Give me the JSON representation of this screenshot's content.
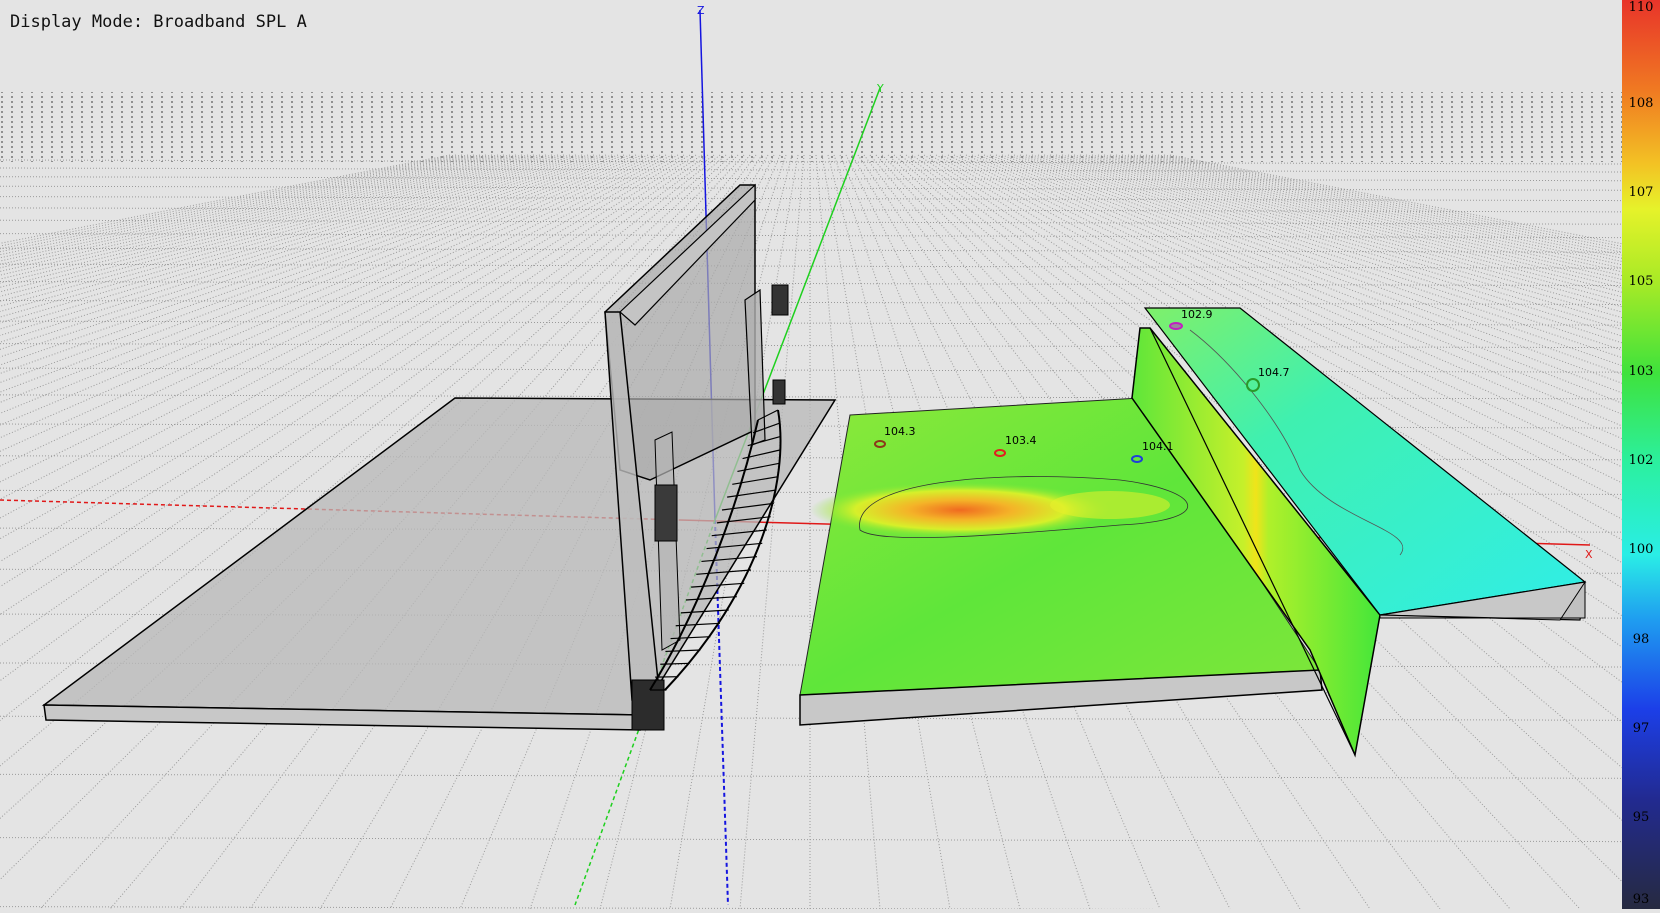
{
  "display_mode": "Display Mode: Broadband SPL A",
  "axes": {
    "x": "X",
    "y": "Y",
    "z": "Z"
  },
  "colorbar": {
    "ticks": [
      "110",
      "108",
      "107",
      "105",
      "103",
      "102",
      "100",
      "98",
      "97",
      "95",
      "93"
    ]
  },
  "probes": [
    {
      "label": "104.3",
      "color": "#8b3a1a"
    },
    {
      "label": "103.4",
      "color": "#e02020"
    },
    {
      "label": "104.1",
      "color": "#1f3fd8"
    },
    {
      "label": "102.9",
      "color": "#c020c0"
    },
    {
      "label": "104.7",
      "color": "#2a9a2a"
    }
  ]
}
